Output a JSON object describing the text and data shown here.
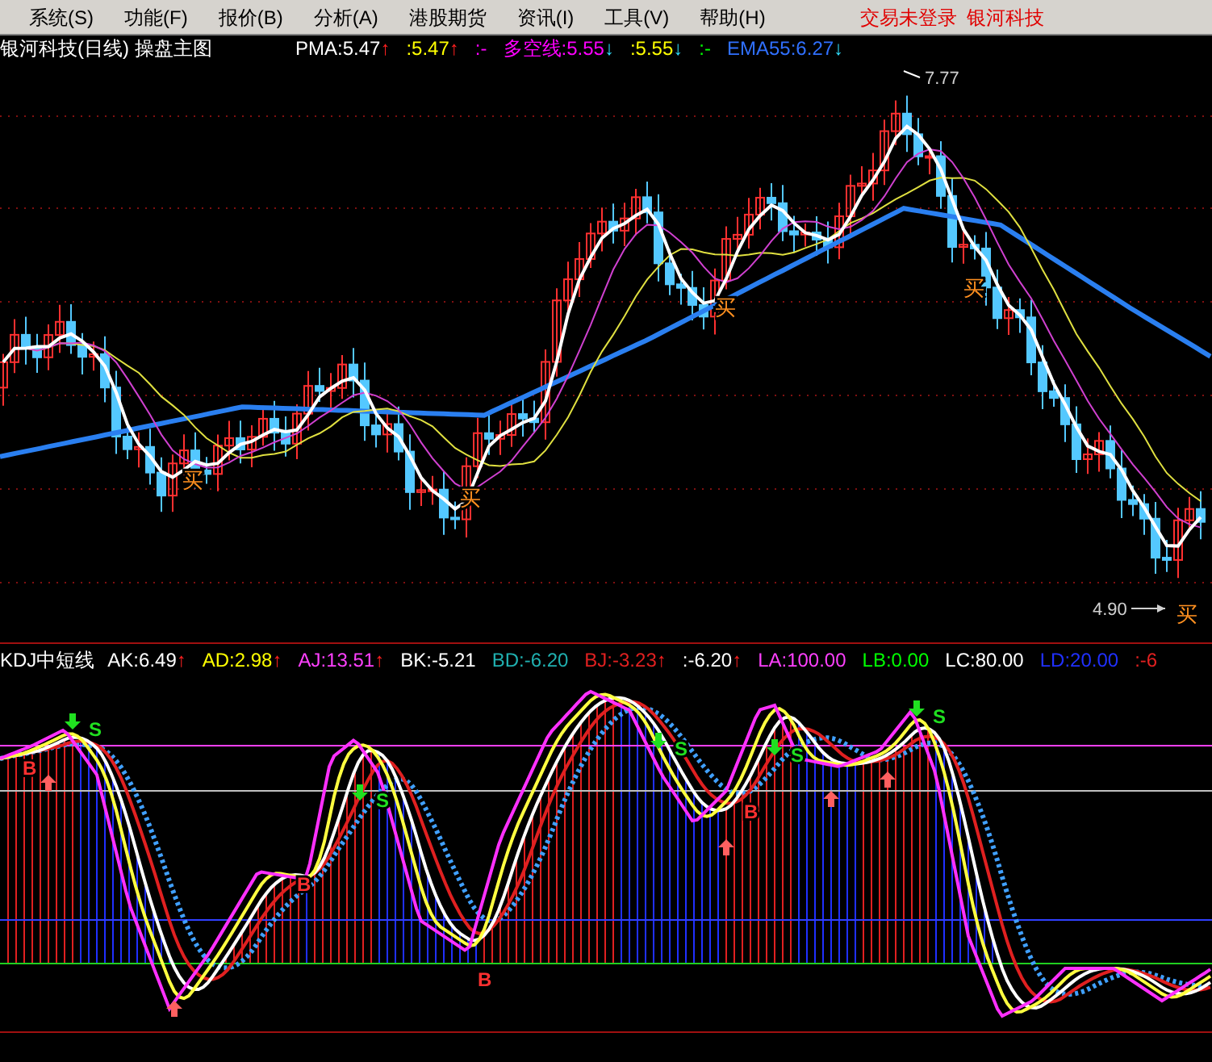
{
  "menu": [
    {
      "label": "系统(S)"
    },
    {
      "label": "功能(F)"
    },
    {
      "label": "报价(B)"
    },
    {
      "label": "分析(A)"
    },
    {
      "label": "港股期货"
    },
    {
      "label": "资讯(I)"
    },
    {
      "label": "工具(V)"
    },
    {
      "label": "帮助(H)"
    }
  ],
  "status": {
    "login": "交易未登录",
    "broker": "银河科技"
  },
  "main_chart": {
    "title": "银河科技(日线) 操盘主图",
    "indicators": [
      {
        "text": "PMA:5.47",
        "color": "#ffffff",
        "arrow": "↑",
        "rising": true
      },
      {
        "text": ":5.47",
        "color": "#ffff00",
        "arrow": "↑",
        "rising": true
      },
      {
        "text": ":-",
        "color": "#ff00ff"
      },
      {
        "text": "多空线:5.55",
        "color": "#ff00ff",
        "arrow": "↓",
        "rising": false
      },
      {
        "text": ":5.55",
        "color": "#ffff00",
        "arrow": "↓",
        "rising": false
      },
      {
        "text": ":-",
        "color": "#00ff00"
      },
      {
        "text": "EMA55:6.27",
        "color": "#3070ff",
        "arrow": "↓",
        "rising": false
      }
    ],
    "high_label": "7.77",
    "low_label": "4.90",
    "buy_marks": [
      "买",
      "买",
      "买",
      "买",
      "买"
    ]
  },
  "sub_chart": {
    "title": "KDJ中短线",
    "indicators": [
      {
        "text": "AK:6.49",
        "color": "#ffffff",
        "arrow": "↑",
        "rising": true
      },
      {
        "text": "AD:2.98",
        "color": "#ffff00",
        "arrow": "↑",
        "rising": true
      },
      {
        "text": "AJ:13.51",
        "color": "#ff40ff",
        "arrow": "↑",
        "rising": true
      },
      {
        "text": "BK:-5.21",
        "color": "#ffffff"
      },
      {
        "text": "BD:-6.20",
        "color": "#20b0b0"
      },
      {
        "text": "BJ:-3.23",
        "color": "#e02020",
        "arrow": "↑",
        "rising": true
      },
      {
        "text": ":-6.20",
        "color": "#ffffff",
        "arrow": "↑",
        "rising": true
      },
      {
        "text": "LA:100.00",
        "color": "#ff40ff"
      },
      {
        "text": "LB:0.00",
        "color": "#00ff00"
      },
      {
        "text": "LC:80.00",
        "color": "#ffffff"
      },
      {
        "text": "LD:20.00",
        "color": "#2030ff"
      },
      {
        "text": ":-6",
        "color": "#e02020"
      }
    ],
    "sell_marks": [
      "S",
      "S",
      "S",
      "S",
      "S"
    ],
    "buy_marks": [
      "B",
      "B",
      "B",
      "B"
    ]
  }
}
